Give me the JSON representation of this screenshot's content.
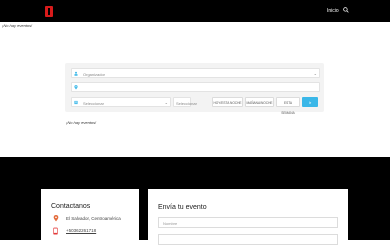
{
  "header": {
    "nav_inicio": "Inicio"
  },
  "no_events_text": "¡No hay eventos!",
  "filters": {
    "organizer_placeholder": "Organizador",
    "category_placeholder": "Seleccionar",
    "place_placeholder": "Seleccionar"
  },
  "buttons": {
    "hoy": "HOY/ESTA NOCHE",
    "manana": "MAÑANA/NOCHE",
    "semana": "ESTA SEMANA",
    "go": "Ir"
  },
  "footer": {
    "contact_title": "Contactanos",
    "location": "El Salvador, Centroamérica",
    "phone": "+50362261718",
    "event_title": "Envía tu evento",
    "event_name_placeholder": "Nombre"
  },
  "colors": {
    "accent": "#3ab7e8",
    "logo": "#d81b1b",
    "footer_bg": "#000000"
  },
  "icons": [
    "logo",
    "search-icon",
    "organizer-icon",
    "location-icon",
    "category-icon",
    "map-pin-icon",
    "phone-icon"
  ]
}
